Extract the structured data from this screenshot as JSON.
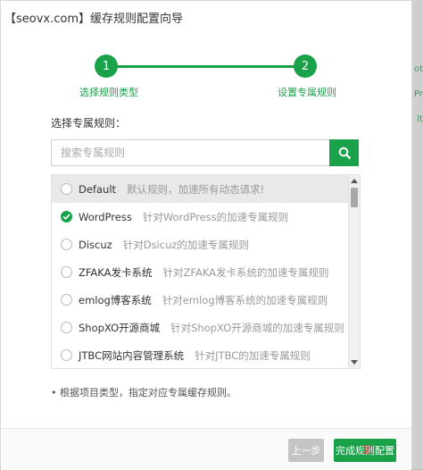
{
  "title": "【seovx.com】缓存规则配置向导",
  "steps": [
    {
      "number": "1",
      "label": "选择规则类型"
    },
    {
      "number": "2",
      "label": "设置专属规则"
    }
  ],
  "section_label": "选择专属规则：",
  "search": {
    "placeholder": "搜索专属规则"
  },
  "rules": [
    {
      "name": "Default",
      "desc": "默认规则，加速所有动态请求!"
    },
    {
      "name": "WordPress",
      "desc": "针对WordPress的加速专属规则"
    },
    {
      "name": "Discuz",
      "desc": "针对Dsicuz的加速专属规则"
    },
    {
      "name": "ZFAKA发卡系统",
      "desc": "针对ZFAKA发卡系统的加速专属规则"
    },
    {
      "name": "emlog博客系统",
      "desc": "针对emlog博客系统的加速专属规则"
    },
    {
      "name": "ShopXO开源商城",
      "desc": "针对ShopXO开源商城的加速专属规则"
    },
    {
      "name": "JTBC网站内容管理系统",
      "desc": "针对JTBC的加速专属规则"
    }
  ],
  "selected_rule": "WordPress",
  "note": "• 根据项目类型，指定对应专属缓存规则。",
  "buttons": {
    "prev": "上一步",
    "finish": "完成规则配置"
  },
  "side_strip": [
    "Pr",
    "lt",
    "ot"
  ],
  "watermark": "室",
  "colors": {
    "accent": "#1aa24a",
    "disabled": "#c4c4c4"
  }
}
